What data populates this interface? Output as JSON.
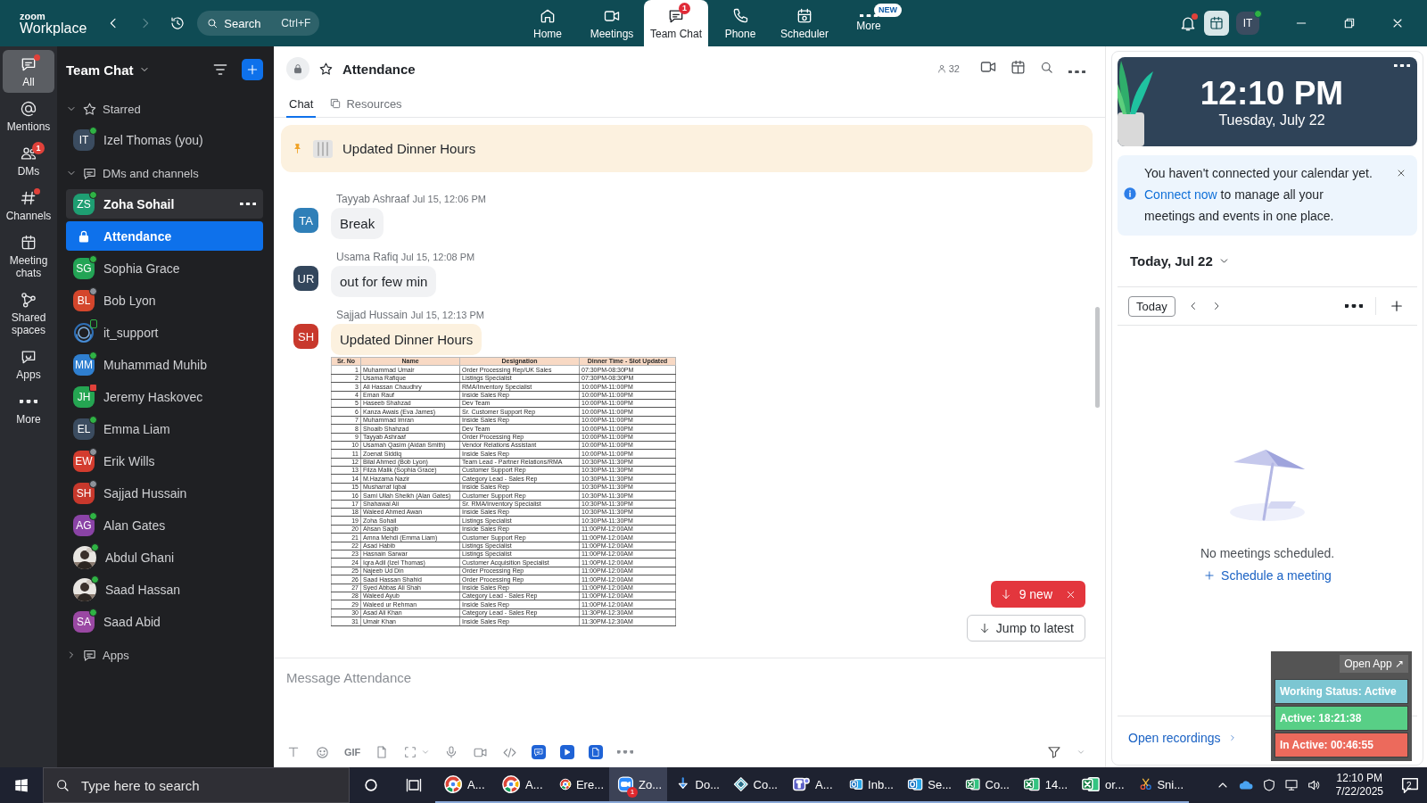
{
  "top_bar": {
    "logo": {
      "line_1": "zoom",
      "line_2": "Workplace"
    },
    "search": {
      "placeholder": "Search",
      "shortcut": "Ctrl+F"
    },
    "nav": [
      {
        "label": "Home",
        "selected": false
      },
      {
        "label": "Meetings",
        "selected": false
      },
      {
        "label": "Team Chat",
        "selected": true,
        "badge": "1"
      },
      {
        "label": "Phone",
        "selected": false
      },
      {
        "label": "Scheduler",
        "selected": false
      },
      {
        "label": "More",
        "selected": false,
        "badge": "NEW"
      }
    ],
    "notifications": {
      "dot": true
    },
    "avatar": {
      "initials": "IT",
      "status": {
        "kind": "online"
      }
    }
  },
  "rail": [
    {
      "label": "All",
      "selected": true,
      "dot": true
    },
    {
      "label": "Mentions",
      "selected": false,
      "dot": false
    },
    {
      "label": "DMs",
      "selected": false,
      "dot": false,
      "badge": "1"
    },
    {
      "label": "Channels",
      "selected": false,
      "dot": true
    },
    {
      "label": "Meeting chats",
      "selected": false,
      "dot": false
    },
    {
      "label": "Shared spaces",
      "selected": false,
      "dot": false
    },
    {
      "label": "Apps",
      "selected": false,
      "dot": false
    },
    {
      "label": "More",
      "selected": false,
      "dot": false
    }
  ],
  "sidebar": {
    "title": "Team Chat",
    "sections": [
      {
        "label": "Starred",
        "expanded": true,
        "items": [
          {
            "name": "Izel Thomas (you)",
            "kind": "person",
            "initials": "IT",
            "color": "#3b4c60",
            "status": {
              "kind": "online"
            },
            "selected": false,
            "hovered": false,
            "unread": false
          }
        ]
      },
      {
        "label": "DMs and channels",
        "expanded": true,
        "items": [
          {
            "name": "Zoha Sohail",
            "kind": "person",
            "initials": "ZS",
            "color": "#1e9e72",
            "status": {
              "kind": "online"
            },
            "selected": false,
            "hovered": true,
            "unread": true
          },
          {
            "name": "Attendance",
            "kind": "channel",
            "selected": true,
            "hovered": false,
            "unread": true
          },
          {
            "name": "Sophia Grace",
            "kind": "person",
            "initials": "SG",
            "color": "#23a455",
            "status": {
              "kind": "online"
            },
            "selected": false,
            "hovered": false,
            "unread": false
          },
          {
            "name": "Bob Lyon",
            "kind": "person",
            "initials": "BL",
            "color": "#d4462c",
            "status": {
              "kind": "away"
            },
            "selected": false,
            "hovered": false,
            "unread": false
          },
          {
            "name": "it_support",
            "kind": "bot",
            "status": {
              "kind": "mobile"
            },
            "selected": false,
            "hovered": false,
            "unread": false
          },
          {
            "name": "Muhammad Muhib",
            "kind": "person",
            "initials": "MM",
            "color": "#2f7fd0",
            "status": {
              "kind": "online"
            },
            "selected": false,
            "hovered": false,
            "unread": false
          },
          {
            "name": "Jeremy Haskovec",
            "kind": "person",
            "initials": "JH",
            "color": "#25a552",
            "status": {
              "kind": "busy"
            },
            "selected": false,
            "hovered": false,
            "unread": false
          },
          {
            "name": "Emma Liam",
            "kind": "person",
            "initials": "EL",
            "color": "#3b4c60",
            "status": {
              "kind": "online"
            },
            "selected": false,
            "hovered": false,
            "unread": false
          },
          {
            "name": "Erik Wills",
            "kind": "person",
            "initials": "EW",
            "color": "#d33c2e",
            "status": {
              "kind": "away"
            },
            "selected": false,
            "hovered": false,
            "unread": false
          },
          {
            "name": "Sajjad Hussain",
            "kind": "person",
            "initials": "SH",
            "color": "#c8382c",
            "status": {
              "kind": "away"
            },
            "selected": false,
            "hovered": false,
            "unread": false
          },
          {
            "name": "Alan Gates",
            "kind": "person",
            "initials": "AG",
            "color": "#8a43a6",
            "status": {
              "kind": "online"
            },
            "selected": false,
            "hovered": false,
            "unread": false
          },
          {
            "name": "Abdul Ghani",
            "status": {
              "kind": "online"
            },
            "selected": false,
            "hovered": false,
            "unread": false
          },
          {
            "name": "Saad Hassan",
            "status": {
              "kind": "online"
            },
            "selected": false,
            "hovered": false,
            "unread": false
          },
          {
            "name": "Saad Abid",
            "kind": "person",
            "initials": "SA",
            "color": "#9a48a3",
            "status": {
              "kind": "online"
            },
            "selected": false,
            "hovered": false,
            "unread": false
          }
        ]
      },
      {
        "label": "Apps",
        "expanded": false
      }
    ]
  },
  "chat": {
    "channel": {
      "title": "Attendance",
      "members": "32"
    },
    "tabs": [
      {
        "label": "Chat",
        "selected": true
      },
      {
        "label": "Resources",
        "selected": false
      }
    ],
    "pinned": {
      "text": "Updated Dinner Hours"
    },
    "messages": [
      {
        "sender": "Tayyab Ashraaf",
        "time": "Jul 15, 12:06 PM",
        "initials": "TA",
        "color": "#2f7fb8",
        "text": "Break",
        "pinned": false
      },
      {
        "sender": "Usama Rafiq",
        "time": "Jul 15, 12:08 PM",
        "initials": "UR",
        "color": "#33465c",
        "text": "out for few min",
        "pinned": false
      },
      {
        "sender": "Sajjad Hussain",
        "time": "Jul 15, 12:13 PM",
        "initials": "SH",
        "color": "#c8382c",
        "text": "Updated Dinner Hours",
        "pinned": true,
        "attachment": {
          "columns": [
            "Sr. No",
            "Name",
            "Designation",
            "Dinner Time - Slot Updated"
          ],
          "rows": [
            [
              "1",
              "Muhammad Umair",
              "Order Processing Rep/UK Sales",
              "07:30PM-08:30PM"
            ],
            [
              "2",
              "Usama Rafique",
              "Listings Specialist",
              "07:30PM-08:30PM"
            ],
            [
              "3",
              "Ali Hassan Chaudhry",
              "RMA/Inventory Specialist",
              "10:00PM-11:00PM"
            ],
            [
              "4",
              "Eman Rauf",
              "Inside Sales Rep",
              "10:00PM-11:00PM"
            ],
            [
              "5",
              "Haseeb Shahzad",
              "Dev Team",
              "10:00PM-11:00PM"
            ],
            [
              "6",
              "Kanza Awais (Eva James)",
              "Sr. Customer Support Rep",
              "10:00PM-11:00PM"
            ],
            [
              "7",
              "Muhammad Imran",
              "Inside Sales Rep",
              "10:00PM-11:00PM"
            ],
            [
              "8",
              "Shoaib Shahzad",
              "Dev Team",
              "10:00PM-11:00PM"
            ],
            [
              "9",
              "Tayyab Ashraaf",
              "Order Processing Rep",
              "10:00PM-11:00PM"
            ],
            [
              "10",
              "Usamah Qasim (Aidan Smith)",
              "Vendor Relations Assistant",
              "10:00PM-11:00PM"
            ],
            [
              "11",
              "Zoenat Siddiq",
              "Inside Sales Rep",
              "10:00PM-11:00PM"
            ],
            [
              "12",
              "Bilal Ahmed (Bob Lyon)",
              "Team Lead - Partner Relations/RMA",
              "10:30PM-11:30PM"
            ],
            [
              "13",
              "Filza Malik (Sophia Grace)",
              "Customer Support Rep",
              "10:30PM-11:30PM"
            ],
            [
              "14",
              "M.Hazama Nazir",
              "Category Lead - Sales Rep",
              "10:30PM-11:30PM"
            ],
            [
              "15",
              "Musharraf Iqbal",
              "Inside Sales Rep",
              "10:30PM-11:30PM"
            ],
            [
              "16",
              "Sami Ullah Sheikh (Alan Gates)",
              "Customer Support Rep",
              "10:30PM-11:30PM"
            ],
            [
              "17",
              "Shahawal Ali",
              "Sr. RMA/Inventory Specialist",
              "10:30PM-11:30PM"
            ],
            [
              "18",
              "Waleed Ahmed Awan",
              "Inside Sales Rep",
              "10:30PM-11:30PM"
            ],
            [
              "19",
              "Zoha Sohail",
              "Listings Specialist",
              "10:30PM-11:30PM"
            ],
            [
              "20",
              "Ahsan Saqib",
              "Inside Sales Rep",
              "11:00PM-12:00AM"
            ],
            [
              "21",
              "Amna Mehdi (Emma Liam)",
              "Customer Support Rep",
              "11:00PM-12:00AM"
            ],
            [
              "22",
              "Asad Habib",
              "Listings Specialist",
              "11:00PM-12:00AM"
            ],
            [
              "23",
              "Hasnain Sarwar",
              "Listings Specialist",
              "11:00PM-12:00AM"
            ],
            [
              "24",
              "Iqra Adil (Izel Thomas)",
              "Customer Acquisition Specialist",
              "11:00PM-12:00AM"
            ],
            [
              "25",
              "Najeeb Ud Din",
              "Order Processing Rep",
              "11:00PM-12:00AM"
            ],
            [
              "26",
              "Saad Hassan Shahid",
              "Order Processing Rep",
              "11:00PM-12:00AM"
            ],
            [
              "27",
              "Syed Abbas Ali Shah",
              "Inside Sales Rep",
              "11:00PM-12:00AM"
            ],
            [
              "28",
              "Waleed Ayub",
              "Category Lead - Sales Rep",
              "11:00PM-12:00AM"
            ],
            [
              "29",
              "Waleed ur Rehman",
              "Inside Sales Rep",
              "11:00PM-12:00AM"
            ],
            [
              "30",
              "Asad Ali Khan",
              "Category Lead - Sales Rep",
              "11:30PM-12:30AM"
            ],
            [
              "31",
              "Umair Khan",
              "Inside Sales Rep",
              "11:30PM-12:30AM"
            ]
          ]
        }
      }
    ],
    "new_messages": "9 new",
    "jump_button": "Jump to latest",
    "composer": {
      "placeholder": "Message Attendance",
      "gif_label": "GIF"
    }
  },
  "calendar": {
    "clock": {
      "time": "12:10 PM",
      "date": "Tuesday, July 22"
    },
    "notice": {
      "text_before": "You haven't connected your calendar yet.",
      "link": "Connect now",
      "text_after": "to manage all your meetings and events in one place."
    },
    "day_picker": "Today, Jul 22",
    "today_button": "Today",
    "empty": {
      "message": "No meetings scheduled.",
      "action": "Schedule a meeting"
    },
    "recordings_link": "Open recordings"
  },
  "status_widget": {
    "open_button": "Open App ↗",
    "rows": [
      {
        "label": "Working Status: Active",
        "color": "#7cc6d2"
      },
      {
        "label": "Active: 18:21:38",
        "color": "#58cf86"
      },
      {
        "label": "In Active: 00:46:55",
        "color": "#ec6a5c"
      }
    ]
  },
  "taskbar": {
    "search_placeholder": "Type here to search",
    "apps": [
      {
        "kind": "chrome",
        "label": "A...",
        "selected": false
      },
      {
        "kind": "chrome",
        "label": "A...",
        "selected": false
      },
      {
        "kind": "chrome",
        "label": "Ere...",
        "selected": false
      },
      {
        "kind": "zoom",
        "label": "Zo...",
        "selected": true,
        "badge": "1"
      },
      {
        "kind": "download",
        "label": "Do...",
        "selected": false
      },
      {
        "kind": "diamond",
        "label": "Co...",
        "selected": false
      },
      {
        "kind": "teams",
        "label": "A...",
        "selected": false
      },
      {
        "kind": "outlook",
        "label": "Inb...",
        "selected": false
      },
      {
        "kind": "outlook",
        "label": "Se...",
        "selected": false
      },
      {
        "kind": "excel",
        "label": "Co...",
        "selected": false
      },
      {
        "kind": "excel",
        "label": "14...",
        "selected": false
      },
      {
        "kind": "excel",
        "label": "or...",
        "selected": false
      },
      {
        "kind": "snip",
        "label": "Sni...",
        "selected": false
      }
    ],
    "clock": {
      "time": "12:10 PM",
      "date": "7/22/2025"
    },
    "notifications": "2"
  }
}
